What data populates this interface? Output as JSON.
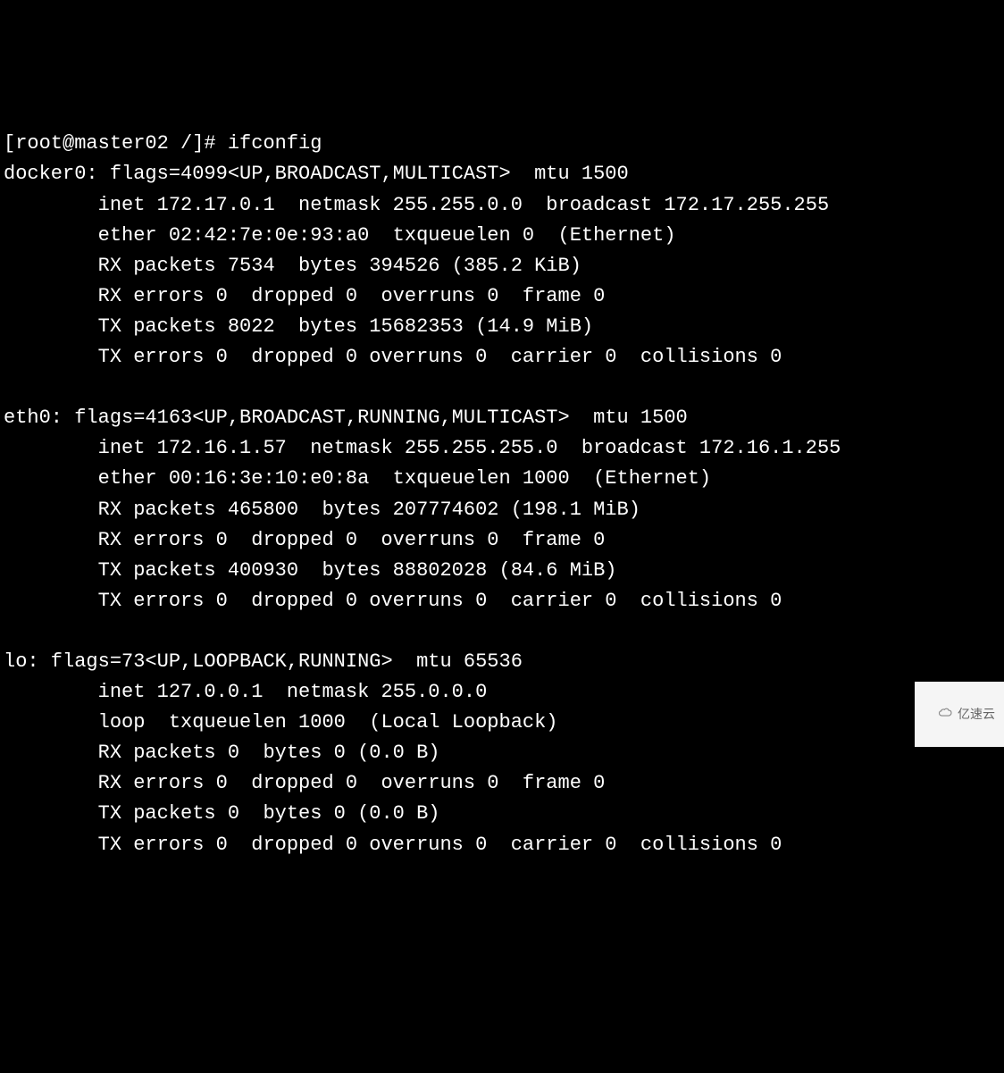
{
  "prompt": "[root@master02 /]# ",
  "command": "ifconfig",
  "interfaces": {
    "docker0": {
      "header": "docker0: flags=4099<UP,BROADCAST,MULTICAST>  mtu 1500",
      "inet": "        inet 172.17.0.1  netmask 255.255.0.0  broadcast 172.17.255.255",
      "ether": "        ether 02:42:7e:0e:93:a0  txqueuelen 0  (Ethernet)",
      "rx_packets": "        RX packets 7534  bytes 394526 (385.2 KiB)",
      "rx_errors": "        RX errors 0  dropped 0  overruns 0  frame 0",
      "tx_packets": "        TX packets 8022  bytes 15682353 (14.9 MiB)",
      "tx_errors": "        TX errors 0  dropped 0 overruns 0  carrier 0  collisions 0"
    },
    "eth0": {
      "header": "eth0: flags=4163<UP,BROADCAST,RUNNING,MULTICAST>  mtu 1500",
      "inet": "        inet 172.16.1.57  netmask 255.255.255.0  broadcast 172.16.1.255",
      "ether": "        ether 00:16:3e:10:e0:8a  txqueuelen 1000  (Ethernet)",
      "rx_packets": "        RX packets 465800  bytes 207774602 (198.1 MiB)",
      "rx_errors": "        RX errors 0  dropped 0  overruns 0  frame 0",
      "tx_packets": "        TX packets 400930  bytes 88802028 (84.6 MiB)",
      "tx_errors": "        TX errors 0  dropped 0 overruns 0  carrier 0  collisions 0"
    },
    "lo": {
      "header": "lo: flags=73<UP,LOOPBACK,RUNNING>  mtu 65536",
      "inet": "        inet 127.0.0.1  netmask 255.0.0.0",
      "loop": "        loop  txqueuelen 1000  (Local Loopback)",
      "rx_packets": "        RX packets 0  bytes 0 (0.0 B)",
      "rx_errors": "        RX errors 0  dropped 0  overruns 0  frame 0",
      "tx_packets": "        TX packets 0  bytes 0 (0.0 B)",
      "tx_errors": "        TX errors 0  dropped 0 overruns 0  carrier 0  collisions 0"
    }
  },
  "watermark": {
    "text": "亿速云"
  }
}
